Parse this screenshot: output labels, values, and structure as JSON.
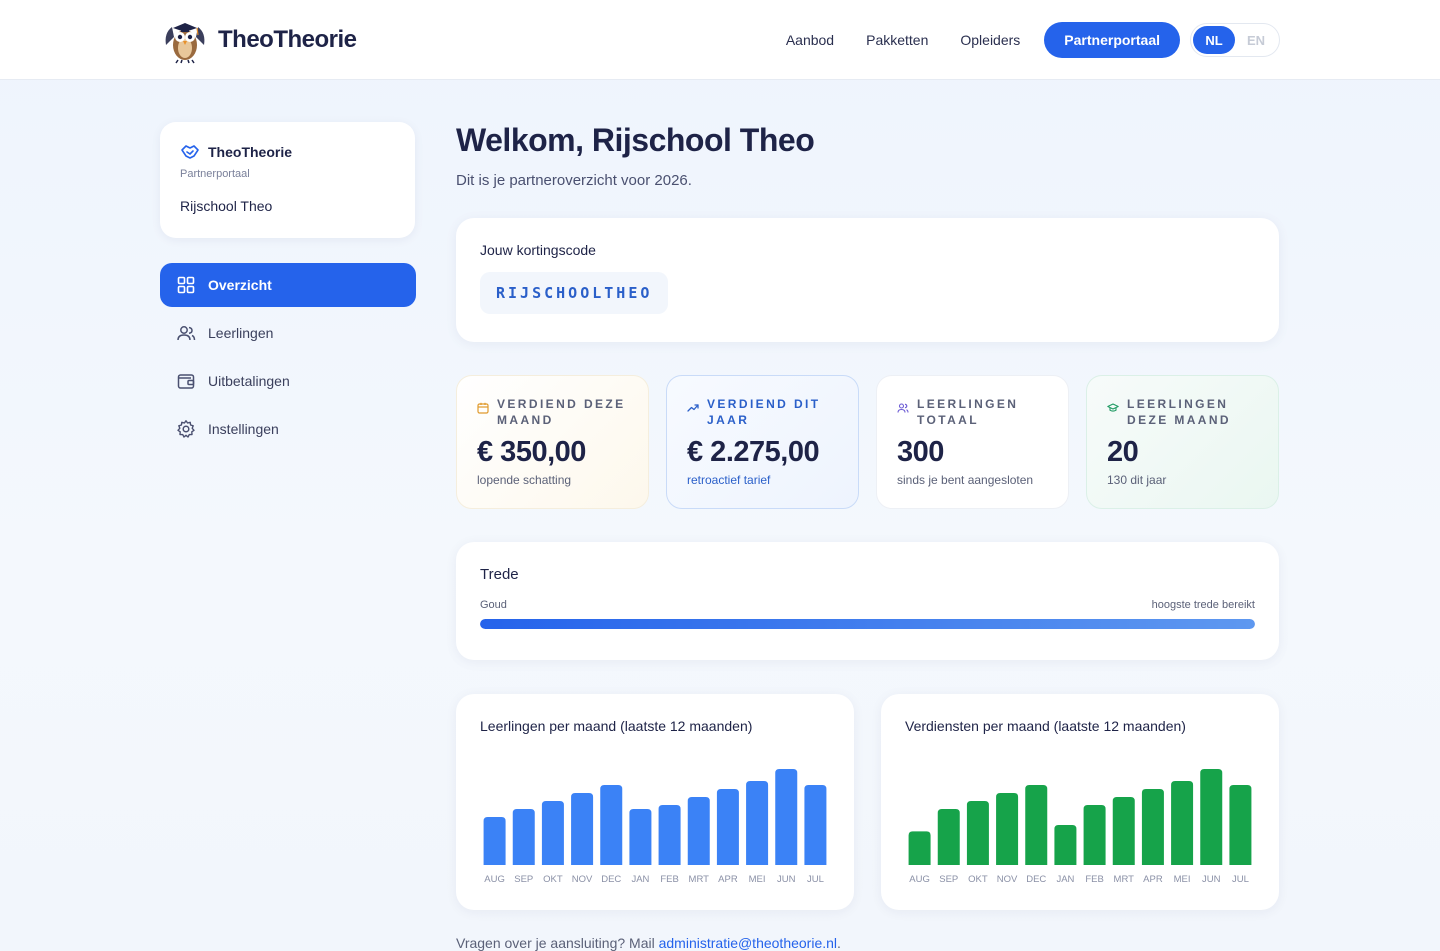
{
  "header": {
    "brand": "TheoTheorie",
    "nav": [
      "Aanbod",
      "Pakketten",
      "Opleiders"
    ],
    "portal_button": "Partnerportaal",
    "lang_active": "NL",
    "lang_inactive": "EN"
  },
  "sidebar": {
    "title": "TheoTheorie",
    "subtitle": "Partnerportaal",
    "school": "Rijschool Theo",
    "items": [
      {
        "label": "Overzicht",
        "icon": "grid-icon"
      },
      {
        "label": "Leerlingen",
        "icon": "users-icon"
      },
      {
        "label": "Uitbetalingen",
        "icon": "wallet-icon"
      },
      {
        "label": "Instellingen",
        "icon": "gear-icon"
      }
    ]
  },
  "main": {
    "title": "Welkom, Rijschool Theo",
    "subtitle": "Dit is je partneroverzicht voor 2026.",
    "code_label": "Jouw kortingscode",
    "code": "RIJSCHOOLTHEO",
    "stats": [
      {
        "label": "Verdiend deze maand",
        "value": "€ 350,00",
        "note": "lopende schatting",
        "icon": "calendar-icon"
      },
      {
        "label": "Verdiend dit jaar",
        "value": "€ 2.275,00",
        "note": "retroactief tarief",
        "icon": "trend-up-icon"
      },
      {
        "label": "Leerlingen totaal",
        "value": "300",
        "note": "sinds je bent aangesloten",
        "icon": "users-icon"
      },
      {
        "label": "Leerlingen deze maand",
        "value": "20",
        "note": "130 dit jaar",
        "icon": "graduation-cap-icon"
      }
    ],
    "tier": {
      "title": "Trede",
      "level": "Goud",
      "status": "hoogste trede bereikt",
      "progress": 1.0
    },
    "footer_text": "Vragen over je aansluiting? Mail ",
    "footer_email": "administratie@theotheorie.nl",
    "footer_end": "."
  },
  "colors": {
    "accent": "#2563eb",
    "chart_blue": "#3b82f6",
    "chart_green": "#16a34a"
  },
  "chart_data": [
    {
      "type": "bar",
      "title": "Leerlingen per maand (laatste 12 maanden)",
      "categories": [
        "AUG",
        "SEP",
        "OKT",
        "NOV",
        "DEC",
        "JAN",
        "FEB",
        "MRT",
        "APR",
        "MEI",
        "JUN",
        "JUL"
      ],
      "values": [
        12,
        14,
        16,
        18,
        20,
        14,
        15,
        17,
        19,
        21,
        24,
        20
      ],
      "ylim": [
        0,
        24
      ]
    },
    {
      "type": "bar",
      "title": "Verdiensten per maand (laatste 12 maanden)",
      "categories": [
        "AUG",
        "SEP",
        "OKT",
        "NOV",
        "DEC",
        "JAN",
        "FEB",
        "MRT",
        "APR",
        "MEI",
        "JUN",
        "JUL"
      ],
      "values": [
        210,
        350,
        400,
        450,
        500,
        250,
        375,
        425,
        475,
        525,
        600,
        500
      ],
      "ylim": [
        0,
        600
      ]
    }
  ]
}
